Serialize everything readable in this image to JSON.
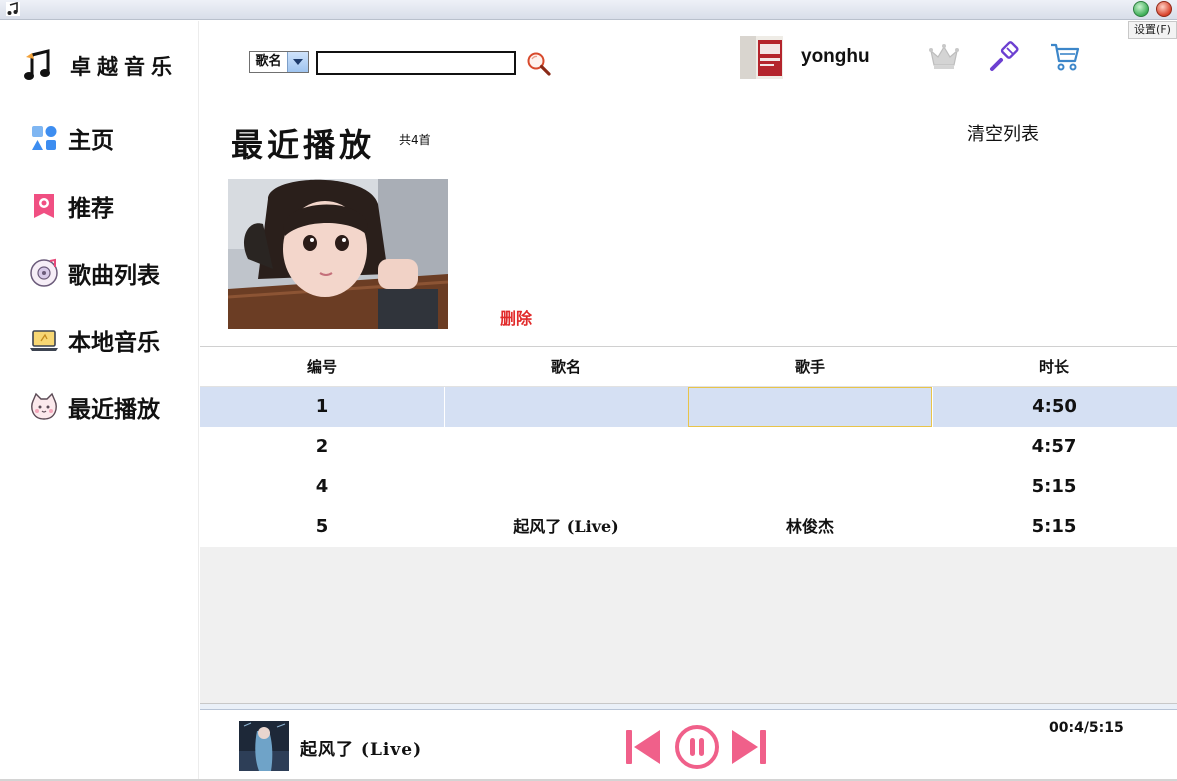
{
  "window": {
    "settings_menu": "设置(F)"
  },
  "sidebar": {
    "logo_text": "卓越音乐",
    "items": [
      {
        "label": "主页",
        "icon": "home-grid-icon"
      },
      {
        "label": "推荐",
        "icon": "recommend-bookmark-icon"
      },
      {
        "label": "歌曲列表",
        "icon": "music-disc-icon"
      },
      {
        "label": "本地音乐",
        "icon": "laptop-icon"
      },
      {
        "label": "最近播放",
        "icon": "cat-face-icon"
      }
    ]
  },
  "header": {
    "search_type": "歌名",
    "search_value": "",
    "username": "yonghu",
    "icons": [
      "crown-icon",
      "brush-icon",
      "cart-icon"
    ]
  },
  "main": {
    "title": "最近播放",
    "count": "共4首",
    "clear_label": "清空列表",
    "delete_label": "删除"
  },
  "table": {
    "headers": [
      "编号",
      "歌名",
      "歌手",
      "时长"
    ],
    "rows": [
      {
        "id": "1",
        "name": "",
        "singer": "",
        "duration": "4:50",
        "selected": true
      },
      {
        "id": "2",
        "name": "",
        "singer": "",
        "duration": "4:57",
        "selected": false
      },
      {
        "id": "4",
        "name": "",
        "singer": "",
        "duration": "5:15",
        "selected": false
      },
      {
        "id": "5",
        "name": "起风了 (Live)",
        "singer": "林俊杰",
        "duration": "5:15",
        "selected": false
      }
    ]
  },
  "player": {
    "title": "起风了 (Live)",
    "time": "00:4/5:15",
    "accent": "#f0608a"
  }
}
